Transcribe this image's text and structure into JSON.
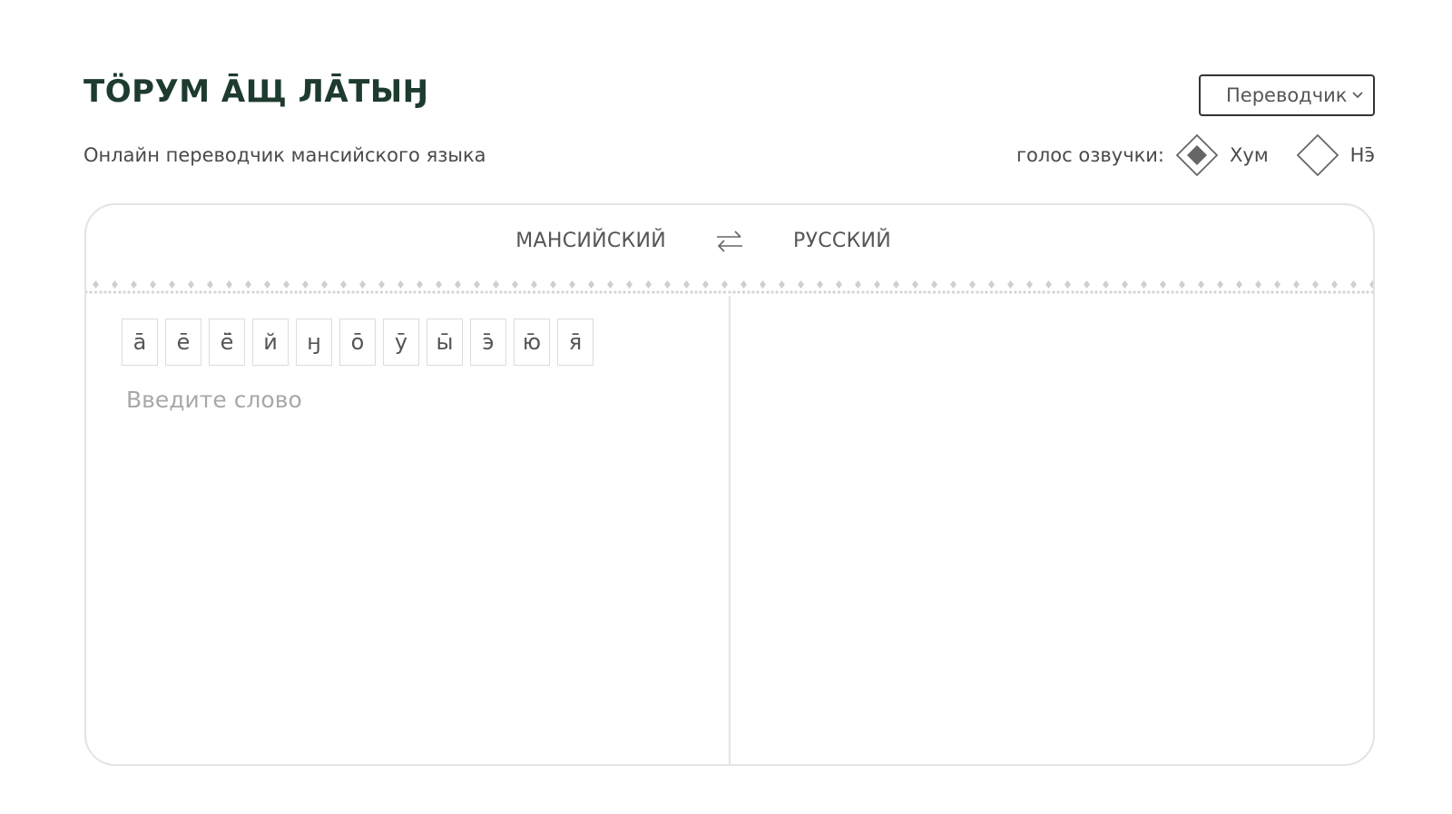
{
  "header": {
    "logo_text": "ТӦРУМ ĀЩ ЛĀТЫӇ",
    "subtitle": "Онлайн переводчик мансийского языка",
    "mode_select": {
      "selected": "Переводчик",
      "icon": "chevron-down-icon"
    },
    "voice": {
      "label": "голос озвучки:",
      "options": [
        {
          "label": "Хум",
          "selected": true
        },
        {
          "label": "Нэ̄",
          "selected": false
        }
      ]
    }
  },
  "translator": {
    "source_lang": "МАНСИЙСКИЙ",
    "target_lang": "РУССКИЙ",
    "swap_icon": "swap-arrows-icon",
    "special_chars": [
      "ā",
      "ē",
      "ё̄",
      "й",
      "ӈ",
      "ō",
      "ӯ",
      "ы̄",
      "э̄",
      "ю̄",
      "я̄"
    ],
    "input_placeholder": "Введите слово",
    "input_value": "",
    "output_value": ""
  },
  "colors": {
    "brand": "#1d3b2e",
    "border": "#e3e3e3",
    "ornament": "#cfcfcf",
    "placeholder": "#a8a8a8"
  }
}
